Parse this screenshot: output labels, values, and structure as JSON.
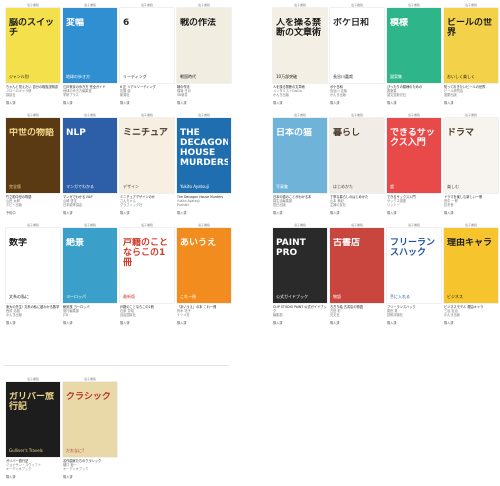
{
  "labels": {
    "header": "電子書籍",
    "status": "購入済"
  },
  "books_left": [
    {
      "title": "ちゃんと覚えたい 自分の取扱説明書",
      "author": "ジローのキャラ研",
      "pub": "講談社",
      "status": "購入済",
      "cover_title": "脳のスイッチ",
      "cover_sub": "ジャンル別",
      "bg": "#f3e04a",
      "fg": "#1a1a1a"
    },
    {
      "title": "江戸東京の歩き方 完全ガイド",
      "author": "地球の歩き方編集室",
      "pub": "学研プラス",
      "status": "購入済",
      "cover_title": "変幅",
      "cover_sub": "地球の歩き方",
      "bg": "#2f8fd1",
      "fg": "#ffffff"
    },
    {
      "title": "6 正 リアルリーディング",
      "author": "佐藤 健",
      "pub": "新潮社",
      "status": "購入済",
      "cover_title": "6",
      "cover_sub": "リーディング",
      "bg": "#ffffff",
      "fg": "#2b2b2b"
    },
    {
      "title": "戦の作法",
      "author": "橋場 日月",
      "pub": "SB新書",
      "status": "購入済",
      "cover_title": "戦の作法",
      "cover_sub": "戦国時代",
      "bg": "#f2ede1",
      "fg": "#1b1b1b"
    },
    {
      "title": "竹之助中世の物語",
      "author": "山田 太郎",
      "pub": "ホビー出版",
      "status": "予約中",
      "cover_title": "中世の物語",
      "cover_sub": "完全版",
      "bg": "#5a3a12",
      "fg": "#f5d98a"
    },
    {
      "title": "マンガでわかる NLP",
      "author": "山崎 啓支",
      "pub": "日本能率協会",
      "status": "購入済",
      "cover_title": "NLP",
      "cover_sub": "マンガでわかる",
      "bg": "#2c5fa8",
      "fg": "#ffffff"
    },
    {
      "title": "ミニチュアデザインのか",
      "author": "さんちゃん",
      "pub": "グラフィック社",
      "status": "購入済",
      "cover_title": "ミニチュア",
      "cover_sub": "デザイン",
      "bg": "#f6efe2",
      "fg": "#4a3b2a"
    },
    {
      "title": "The Decagon House Murders",
      "author": "Yukito Ayatsuji",
      "pub": "Pushkin",
      "status": "購入済",
      "cover_title": "THE DECAGON HOUSE MURDERS",
      "cover_sub": "Yukito Ayatsuji",
      "bg": "#1f6fb0",
      "fg": "#ffffff"
    },
    {
      "title": "東大の先生! 文系の私に超わかる数学",
      "author": "西成 活裕",
      "pub": "かんき出版",
      "status": "購入済",
      "cover_title": "数学",
      "cover_sub": "文系の私に",
      "bg": "#ffffff",
      "fg": "#1a1a1a"
    },
    {
      "title": "絶景旅 ヨーロッパ",
      "author": "旅行編集部",
      "pub": "JTB",
      "status": "購入済",
      "cover_title": "絶景",
      "cover_sub": "ヨーロッパ",
      "bg": "#3aa0c9",
      "fg": "#ffffff"
    },
    {
      "title": "戸籍のことならこの1冊",
      "author": "石原 豊昭",
      "pub": "自由国民社",
      "status": "購入済",
      "cover_title": "戸籍のことならこの1冊",
      "cover_sub": "最新版",
      "bg": "#ffffff",
      "fg": "#d23a2a"
    },
    {
      "title": "「あいうえ」の本 これ一冊",
      "author": "鈴木 花子",
      "pub": "ナツメ社",
      "status": "購入済",
      "cover_title": "あいうえ",
      "cover_sub": "これ一冊",
      "bg": "#f28c1e",
      "fg": "#ffffff"
    }
  ],
  "books_right": [
    {
      "title": "人を操る禁断の文章術",
      "author": "メンタリストDaiGo",
      "pub": "かんき出版",
      "status": "購入済",
      "cover_title": "人を操る禁断の文章術",
      "cover_sub": "10万部突破",
      "bg": "#f4efe4",
      "fg": "#1a1a1a"
    },
    {
      "title": "ボケ日和",
      "author": "長谷川 嘉哉",
      "pub": "かんき出版",
      "status": "購入済",
      "cover_title": "ボケ日和",
      "cover_sub": "長谷川嘉哉",
      "bg": "#ffffff",
      "fg": "#2a2a2a"
    },
    {
      "title": "ぴったりの模様のための",
      "author": "図案集",
      "pub": "誠文堂新光社",
      "status": "購入済",
      "cover_title": "模様",
      "cover_sub": "図案集",
      "bg": "#2fb58a",
      "fg": "#ffffff"
    },
    {
      "title": "知っておきたいビールの世界",
      "author": "ビール研究会",
      "pub": "旭屋出版",
      "status": "購入済",
      "cover_title": "ビールの世界",
      "cover_sub": "おいしく楽しく",
      "bg": "#f3d24a",
      "fg": "#1a1a1a"
    },
    {
      "title": "日本の猫のことがわかる本",
      "author": "猫生活編集部",
      "pub": "辰巳出版",
      "status": "購入済",
      "cover_title": "日本の猫",
      "cover_sub": "写真集",
      "bg": "#6fb3d8",
      "fg": "#ffffff"
    },
    {
      "title": "丁寧な暮らしのはじめかた",
      "author": "山本 美紀",
      "pub": "主婦の友社",
      "status": "購入済",
      "cover_title": "暮らし",
      "cover_sub": "はじめかた",
      "bg": "#f1ece6",
      "fg": "#4a3b2a"
    },
    {
      "title": "できるサックス入門",
      "author": "サックス講座",
      "pub": "リットー",
      "status": "購入済",
      "cover_title": "できるサックス入門",
      "cover_sub": "超",
      "bg": "#e84a4a",
      "fg": "#ffffff"
    },
    {
      "title": "ドラマを楽しむ新しい一冊",
      "author": "田中 一郎",
      "pub": "幻冬舎",
      "status": "購入済",
      "cover_title": "ドラマ",
      "cover_sub": "楽しむ",
      "bg": "#f7f3ee",
      "fg": "#4a3b2a"
    },
    {
      "title": "CLIP STUDIO PAINT 公式ガイドブック",
      "author": "編集部",
      "pub": "翔泳社",
      "status": "購入済",
      "cover_title": "PAINT PRO",
      "cover_sub": "公式ガイドブック",
      "bg": "#2a2a2a",
      "fg": "#ffffff"
    },
    {
      "title": "ちぎり絵 古書店の物語",
      "author": "古田 彩",
      "pub": "光文社",
      "status": "購入済",
      "cover_title": "古書店",
      "cover_sub": "物語",
      "bg": "#c9463e",
      "fg": "#ffffff"
    },
    {
      "title": "フリーランスハック",
      "author": "廣田 真",
      "pub": "技術評論社",
      "status": "購入済",
      "cover_title": "フリーランスハック",
      "cover_sub": "手に入れる",
      "bg": "#ffffff",
      "fg": "#1e4fa3"
    },
    {
      "title": "ビジネスモデル 理由キャラ",
      "author": "三谷 宏治",
      "pub": "かんき出版",
      "status": "購入済",
      "cover_title": "理由キャラ",
      "cover_sub": "ビジネス",
      "bg": "#f6c52e",
      "fg": "#1a1a1a"
    }
  ],
  "books_bottom": [
    {
      "title": "ガリバー旅行記",
      "author": "ジョナサン・スウィフト",
      "pub": "オーディオブック",
      "status": "購入済",
      "cover_title": "ガリバー旅行記",
      "cover_sub": "Gulliver's Travels",
      "bg": "#1d1d1d",
      "fg": "#f0d98a"
    },
    {
      "title": "名作曲家たちのクラシック",
      "author": "樋口 裕一",
      "pub": "オーディオブック",
      "status": "購入済",
      "cover_title": "クラシック",
      "cover_sub": "だれなに?",
      "bg": "#e9d9a8",
      "fg": "#b3352c"
    }
  ]
}
